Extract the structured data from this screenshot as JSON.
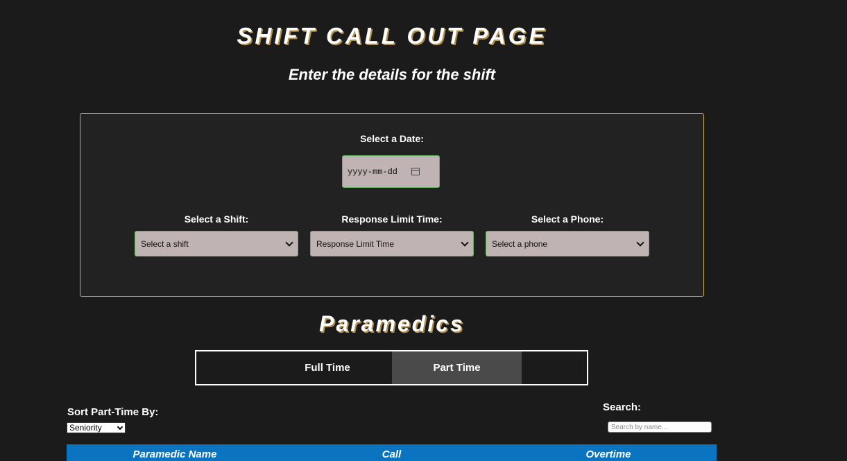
{
  "header": {
    "title": "SHIFT CALL OUT PAGE",
    "subtitle": "Enter the details for the shift"
  },
  "form": {
    "date_label": "Select a Date:",
    "date_placeholder": "yyyy-mm-dd",
    "shift_label": "Select a Shift:",
    "shift_value": "Select a shift",
    "response_label": "Response Limit Time:",
    "response_value": "Response Limit Time",
    "phone_label": "Select a Phone:",
    "phone_value": "Select a phone"
  },
  "paramedics": {
    "title": "Paramedics",
    "tabs": [
      {
        "label": "Full Time",
        "active": false
      },
      {
        "label": "Part Time",
        "active": true
      }
    ]
  },
  "controls": {
    "sort_label": "Sort Part-Time By:",
    "sort_value": "Seniority",
    "search_label": "Search:",
    "search_placeholder": "Search by name..."
  },
  "table": {
    "columns": [
      "Paramedic Name",
      "Call",
      "Overtime"
    ],
    "header_color": "#0a74c0"
  },
  "colors": {
    "background": "#1b1b1b",
    "panel_border": "#c9b24a",
    "input_bg": "#bfb3b3",
    "input_border": "#5fb55f",
    "active_tab": "#4a4a4a"
  }
}
